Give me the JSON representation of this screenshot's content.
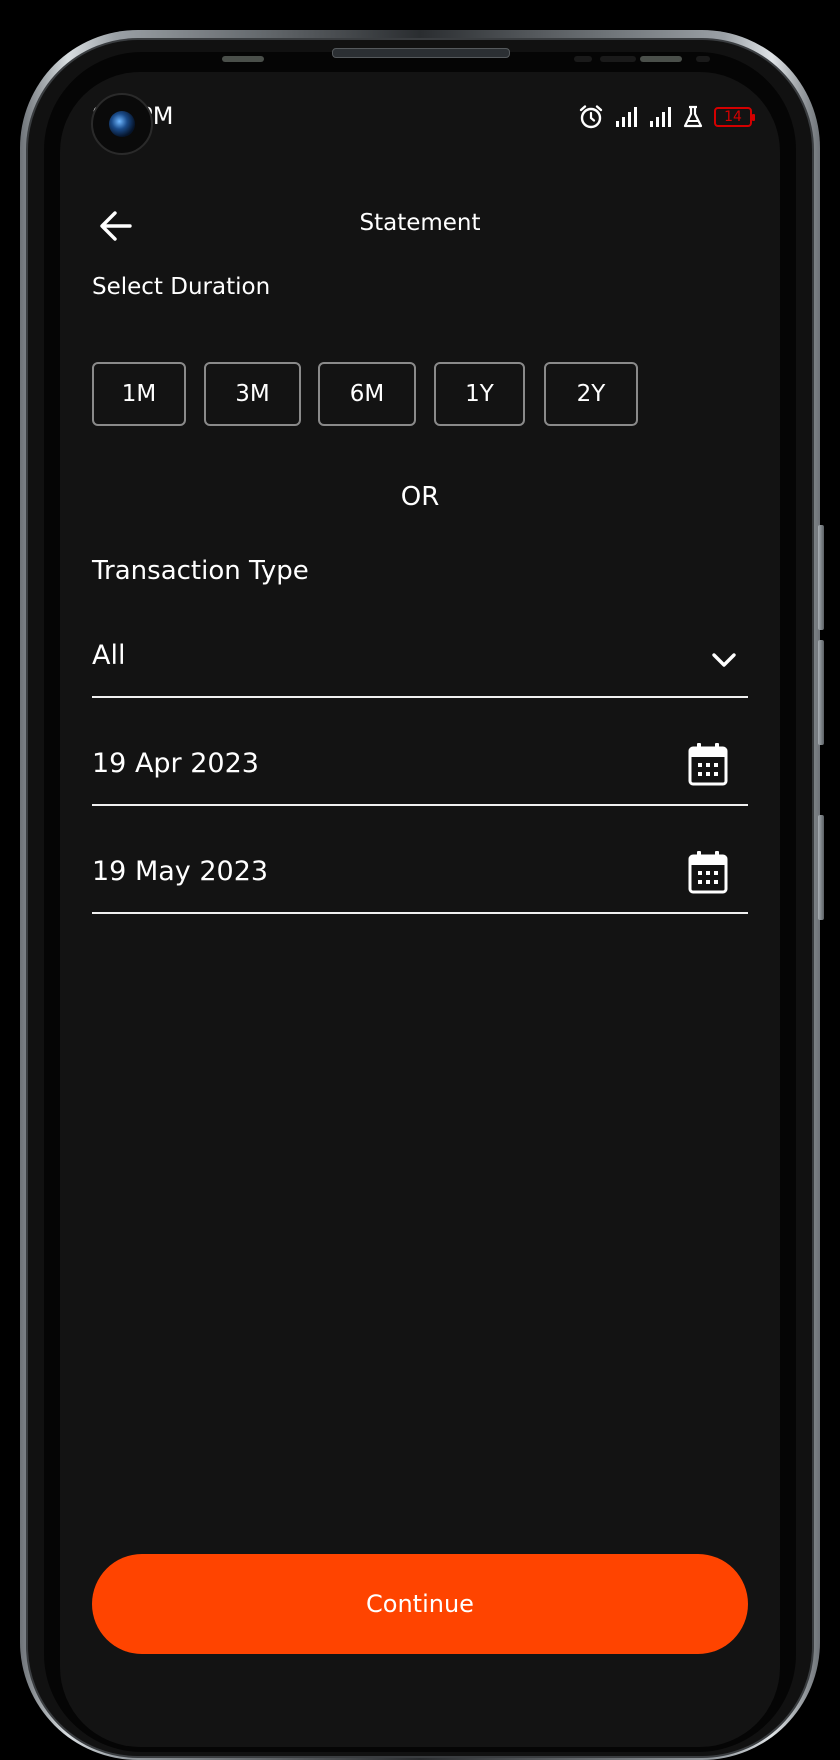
{
  "status_bar": {
    "time": "9:5 PM",
    "battery_level": "14",
    "icons": [
      "alarm-icon",
      "signal-icon",
      "signal-icon",
      "lab-flask-icon",
      "battery-icon"
    ]
  },
  "header": {
    "title": "Statement",
    "back_icon": "arrow-left-icon"
  },
  "duration": {
    "label": "Select Duration",
    "options": [
      "1M",
      "3M",
      "6M",
      "1Y",
      "2Y"
    ]
  },
  "or_label": "OR",
  "transaction_type": {
    "label": "Transaction Type",
    "value": "All",
    "icon": "chevron-down-icon"
  },
  "date_range": {
    "from": "19 Apr 2023",
    "to": "19 May 2023",
    "icon": "calendar-icon"
  },
  "continue_label": "Continue",
  "colors": {
    "background": "#131313",
    "accent": "#ff4400",
    "text": "#ffffff",
    "chip_border": "#8a8a8a",
    "battery_low": "#d40000"
  }
}
